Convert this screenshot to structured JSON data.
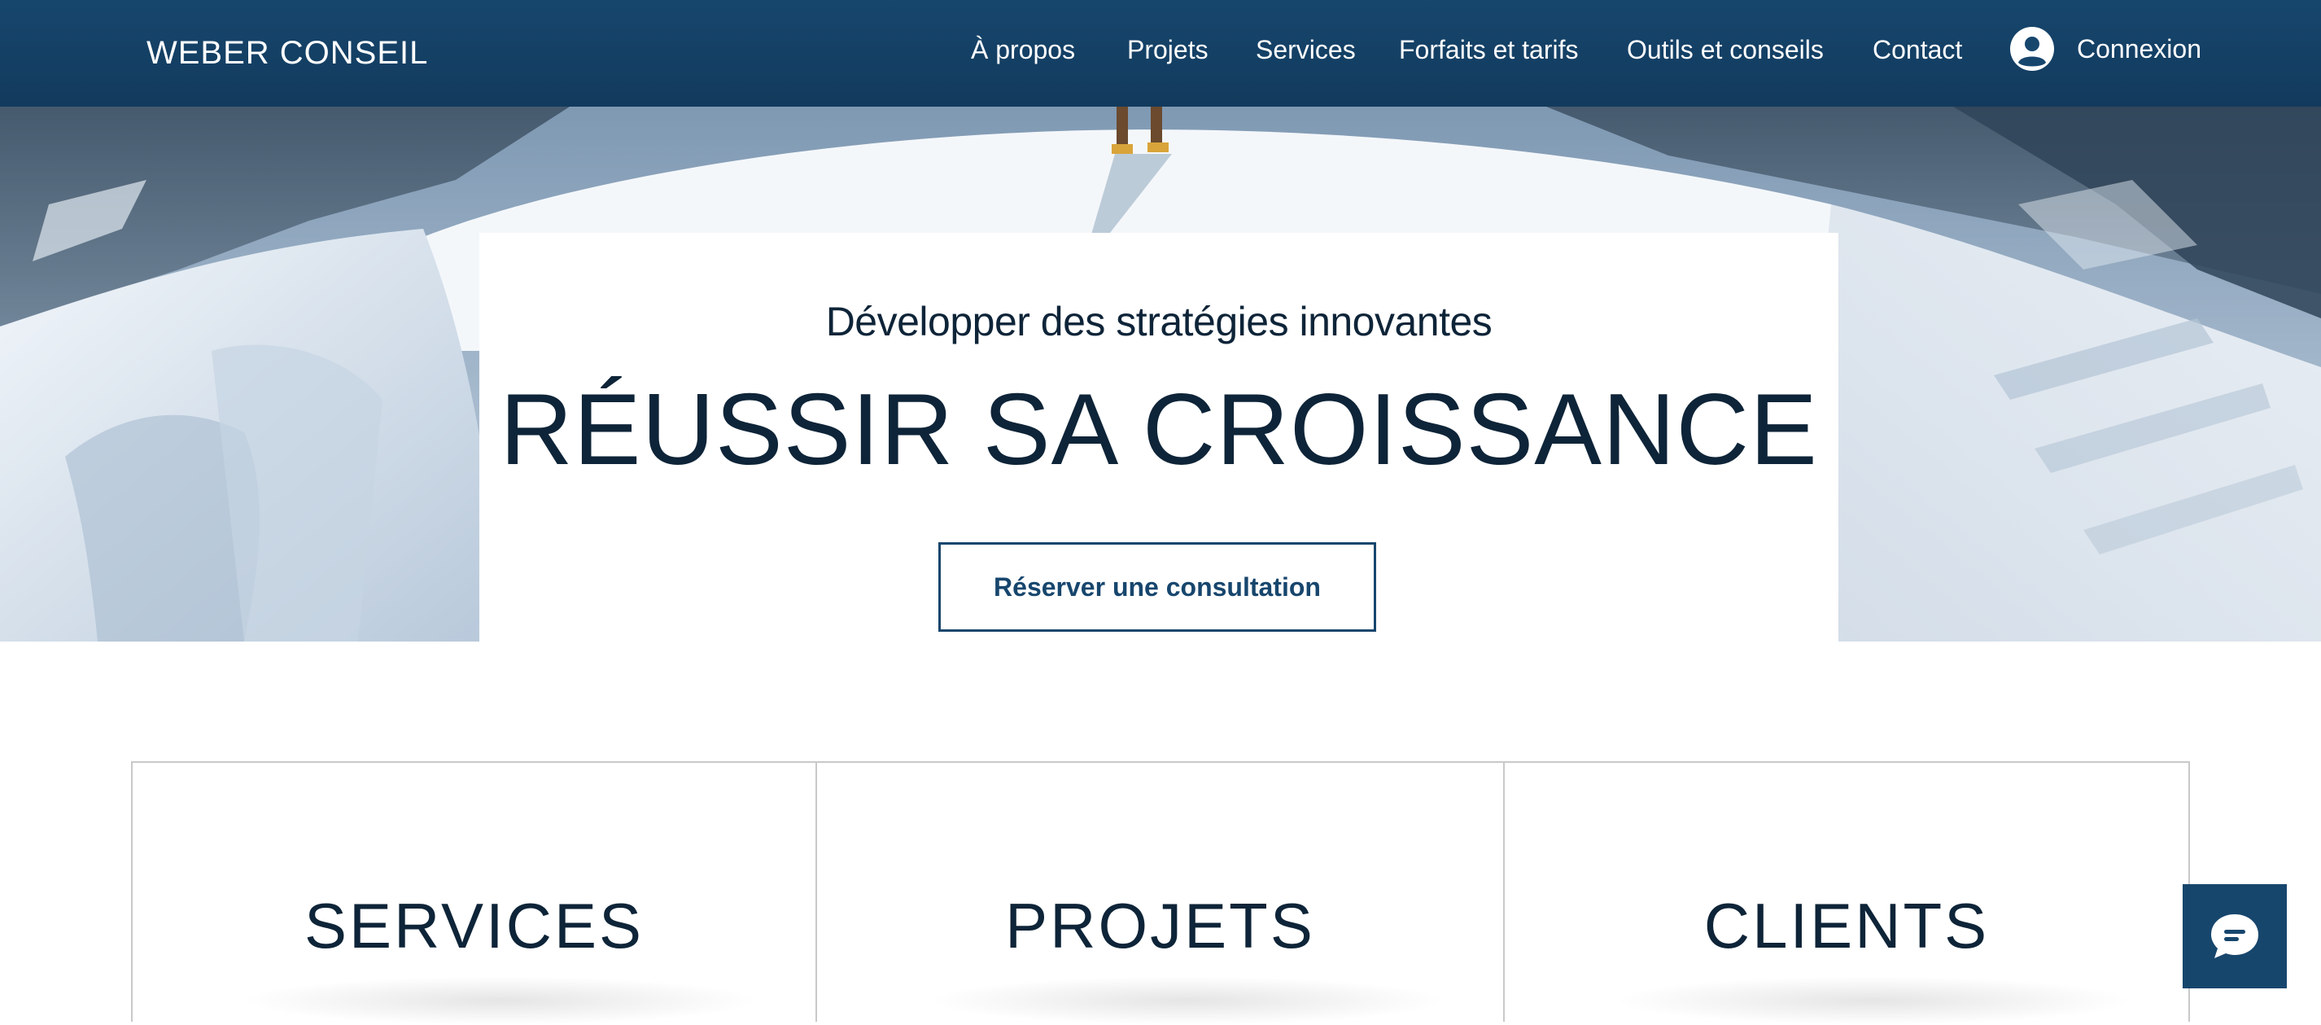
{
  "header": {
    "logo": "WEBER CONSEIL",
    "nav": [
      {
        "label": "À propos"
      },
      {
        "label": "Projets"
      },
      {
        "label": "Services"
      },
      {
        "label": "Forfaits et tarifs"
      },
      {
        "label": "Outils et conseils"
      },
      {
        "label": "Contact"
      }
    ],
    "login_label": "Connexion",
    "background_color": "#17466d"
  },
  "hero": {
    "subtitle": "Développer des stratégies innovantes",
    "title": "RÉUSSIR SA CROISSANCE",
    "cta_label": "Réserver une consultation",
    "background": "snowy mountain ridge photo"
  },
  "boxes": [
    {
      "title": "SERVICES"
    },
    {
      "title": "PROJETS"
    },
    {
      "title": "CLIENTS"
    }
  ],
  "chat": {
    "icon": "chat-bubble-icon",
    "color": "#17466d"
  },
  "colors": {
    "text_dark": "#0e2438",
    "accent": "#17466d"
  }
}
